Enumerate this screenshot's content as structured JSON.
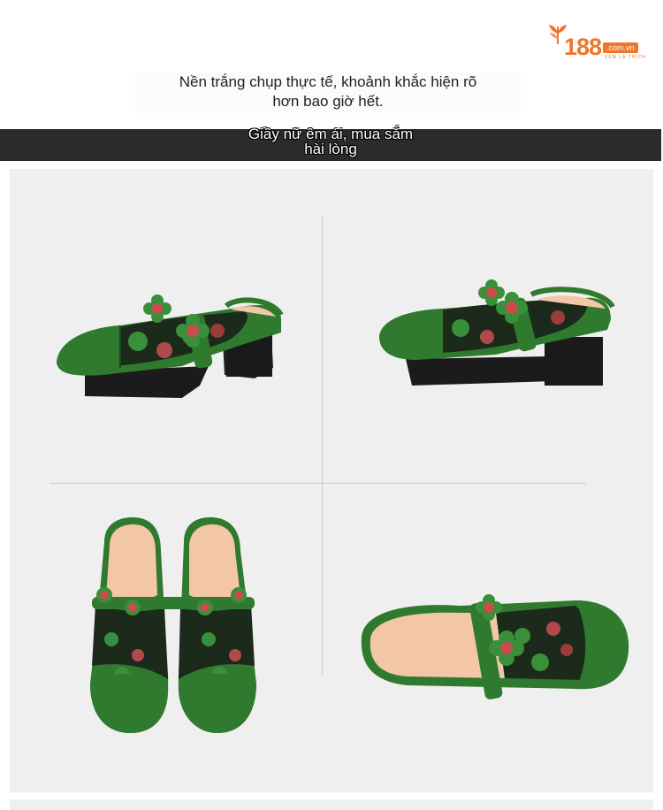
{
  "logo": {
    "number": "188",
    "domain": ".com.vn",
    "tagline": "XEM LÀ THÍCH"
  },
  "intro": {
    "line1": "Nền trắng chụp thực tế, khoảnh khắc hiện rõ",
    "line2": "hơn bao giờ hết."
  },
  "banner": {
    "line1": "Giầy nữ êm ái, mua sắm",
    "line2": "hài lòng"
  },
  "colors": {
    "brand": "#f0752a",
    "banner_bg": "#2b2b2b",
    "panel_bg": "#efefef",
    "shoe_green": "#2f7a2e"
  }
}
